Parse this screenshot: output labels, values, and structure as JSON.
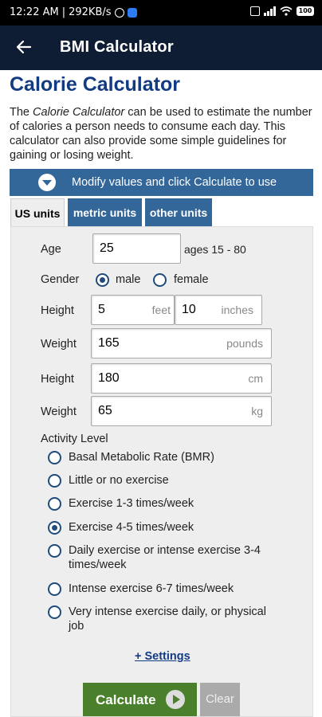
{
  "status_bar": {
    "time": "12:22 AM",
    "separator": "|",
    "speed": "292KB/s",
    "battery": "100"
  },
  "app_bar": {
    "title": "BMI Calculator"
  },
  "page": {
    "title": "Calorie Calculator",
    "intro_italic": "Calorie Calculator",
    "intro_prefix": "The ",
    "intro_rest": " can be used to estimate the number of calories a person needs to consume each day. This calculator can also provide some simple guidelines for gaining or losing weight."
  },
  "modify_bar": {
    "label": "Modify values and click Calculate to use"
  },
  "tabs": [
    {
      "label": "US units",
      "active": true
    },
    {
      "label": "metric units",
      "active": false
    },
    {
      "label": "other units",
      "active": false
    }
  ],
  "form": {
    "age": {
      "label": "Age",
      "value": "25",
      "hint": "ages 15 - 80"
    },
    "gender": {
      "label": "Gender",
      "options": [
        "male",
        "female"
      ],
      "selected": "male"
    },
    "height_us": {
      "label": "Height",
      "feet": "5",
      "feet_unit": "feet",
      "inches": "10",
      "inches_unit": "inches"
    },
    "weight_us": {
      "label": "Weight",
      "value": "165",
      "unit": "pounds"
    },
    "height_metric": {
      "label": "Height",
      "value": "180",
      "unit": "cm"
    },
    "weight_metric": {
      "label": "Weight",
      "value": "65",
      "unit": "kg"
    },
    "activity": {
      "label": "Activity Level",
      "options": [
        "Basal Metabolic Rate (BMR)",
        "Little or no exercise",
        "Exercise 1-3 times/week",
        "Exercise 4-5 times/week",
        "Daily exercise or intense exercise 3-4 times/week",
        "Intense exercise 6-7 times/week",
        "Very intense exercise daily, or physical job"
      ],
      "selected_index": 3
    },
    "settings_link": "+ Settings",
    "calculate": "Calculate",
    "clear": "Clear"
  },
  "colors": {
    "app_bar": "#0e1d33",
    "title_blue": "#123b82",
    "bar_blue": "#336699",
    "calculate_green": "#4a7f2c",
    "clear_gray": "#aaaaaa"
  }
}
